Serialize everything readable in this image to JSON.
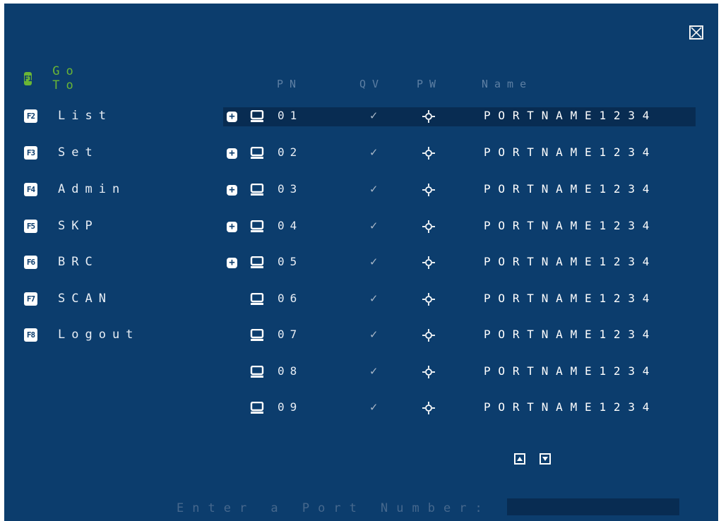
{
  "close_icon": "close-icon",
  "menu": [
    {
      "key": "F1",
      "label": "Go To",
      "active": true
    },
    {
      "key": "F2",
      "label": "List"
    },
    {
      "key": "F3",
      "label": "Set"
    },
    {
      "key": "F4",
      "label": "Admin"
    },
    {
      "key": "F5",
      "label": "SKP"
    },
    {
      "key": "F6",
      "label": "BRC"
    },
    {
      "key": "F7",
      "label": "SCAN"
    },
    {
      "key": "F8",
      "label": "Logout"
    }
  ],
  "table": {
    "headers": {
      "pn": "PN",
      "qv": "QV",
      "pw": "PW",
      "name": "Name"
    },
    "rows": [
      {
        "expand": true,
        "pn": "01",
        "qv": "✓",
        "pw": "sun-icon",
        "name": "PORTNAME1234",
        "selected": true
      },
      {
        "expand": true,
        "pn": "02",
        "qv": "✓",
        "pw": "sun-icon",
        "name": "PORTNAME1234"
      },
      {
        "expand": true,
        "pn": "03",
        "qv": "✓",
        "pw": "sun-icon",
        "name": "PORTNAME1234"
      },
      {
        "expand": true,
        "pn": "04",
        "qv": "✓",
        "pw": "sun-icon",
        "name": "PORTNAME1234"
      },
      {
        "expand": true,
        "pn": "05",
        "qv": "✓",
        "pw": "sun-icon",
        "name": "PORTNAME1234"
      },
      {
        "expand": false,
        "pn": "06",
        "qv": "✓",
        "pw": "sun-icon",
        "name": "PORTNAME1234"
      },
      {
        "expand": false,
        "pn": "07",
        "qv": "✓",
        "pw": "sun-icon",
        "name": "PORTNAME1234"
      },
      {
        "expand": false,
        "pn": "08",
        "qv": "✓",
        "pw": "sun-icon",
        "name": "PORTNAME1234"
      },
      {
        "expand": false,
        "pn": "09",
        "qv": "✓",
        "pw": "sun-icon",
        "name": "PORTNAME1234"
      }
    ]
  },
  "scroll": {
    "up_icon": "scroll-up-icon",
    "down_icon": "scroll-down-icon"
  },
  "prompt": {
    "label": "Enter a Port Number:",
    "value": ""
  },
  "colors": {
    "background": "#0c3d6d",
    "active": "#6ab635",
    "selected_row": "#082c52"
  }
}
